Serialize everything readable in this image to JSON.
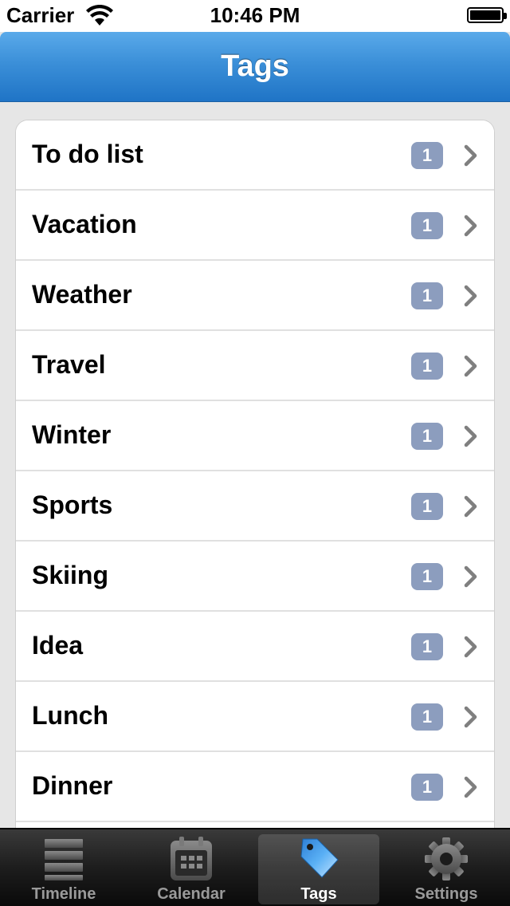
{
  "status_bar": {
    "carrier": "Carrier",
    "time": "10:46 PM"
  },
  "nav": {
    "title": "Tags"
  },
  "tags": [
    {
      "label": "To do list",
      "count": "1"
    },
    {
      "label": "Vacation",
      "count": "1"
    },
    {
      "label": "Weather",
      "count": "1"
    },
    {
      "label": "Travel",
      "count": "1"
    },
    {
      "label": "Winter",
      "count": "1"
    },
    {
      "label": "Sports",
      "count": "1"
    },
    {
      "label": "Skiing",
      "count": "1"
    },
    {
      "label": "Idea",
      "count": "1"
    },
    {
      "label": "Lunch",
      "count": "1"
    },
    {
      "label": "Dinner",
      "count": "1"
    }
  ],
  "tab_bar": {
    "items": [
      {
        "label": "Timeline",
        "icon": "timeline-icon"
      },
      {
        "label": "Calendar",
        "icon": "calendar-icon"
      },
      {
        "label": "Tags",
        "icon": "tag-icon",
        "selected": true
      },
      {
        "label": "Settings",
        "icon": "gear-icon"
      }
    ]
  },
  "colors": {
    "nav_blue": "#2a7fd0",
    "badge": "#8c9dbe",
    "tab_selected_icon": "#4aa3f0"
  }
}
